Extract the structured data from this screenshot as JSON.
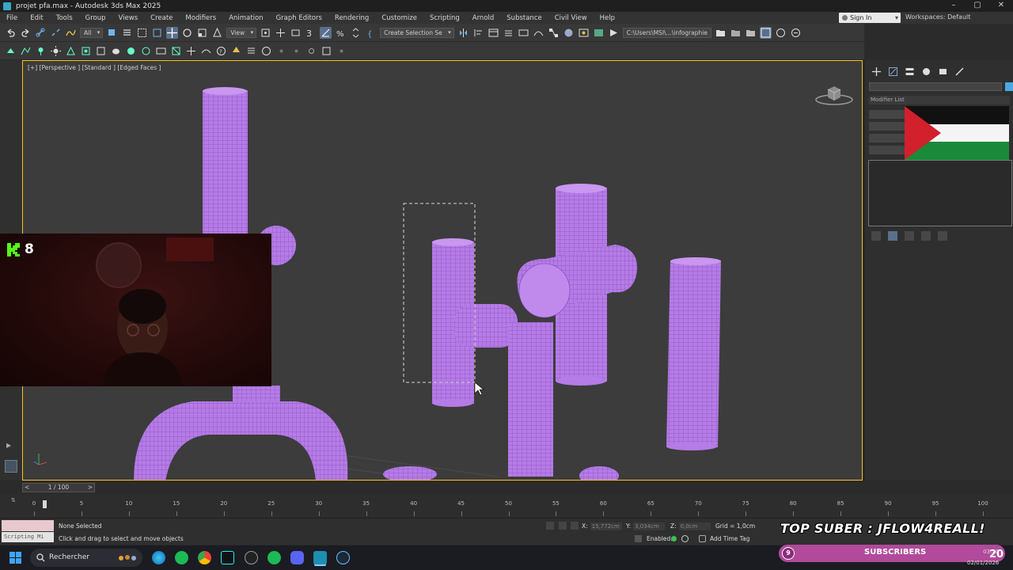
{
  "window": {
    "title": "projet pfa.max - Autodesk 3ds Max 2025",
    "controls": [
      "–",
      "▢",
      "✕"
    ]
  },
  "menu": {
    "items": [
      "File",
      "Edit",
      "Tools",
      "Group",
      "Views",
      "Create",
      "Modifiers",
      "Animation",
      "Graph Editors",
      "Rendering",
      "Customize",
      "Scripting",
      "Arnold",
      "Substance",
      "Civil View",
      "Help"
    ],
    "sign_in": "Sign In",
    "workspaces_label": "Workspaces:",
    "workspace_value": "Default"
  },
  "toolbar": {
    "selection_filter": "All",
    "ref_coord": "View",
    "named_selection": "Create Selection Se",
    "project_path": "C:\\Users\\MSI\\...\\infographie"
  },
  "viewport": {
    "label": "[+] [Perspective ] [Standard ] [Edged Faces ]",
    "object_color": "#b57be6",
    "wire_color": "#7a3fb0",
    "border_color": "#f5c518"
  },
  "command_panel": {
    "modifier_list": "Modifier List"
  },
  "webcam_overlay": {
    "kick_count": "8",
    "kick_color": "#53fc18"
  },
  "timeline": {
    "frame_display": "1 / 100",
    "ticks": [
      0,
      5,
      10,
      15,
      20,
      25,
      30,
      35,
      40,
      45,
      50,
      55,
      60,
      65,
      70,
      75,
      80,
      85,
      90,
      95,
      100
    ]
  },
  "status": {
    "selection": "None Selected",
    "prompt": "Click and drag to select and move objects",
    "script_label": "Scripting Mi",
    "x_label": "X:",
    "x_value": "15,772cm",
    "y_label": "Y:",
    "y_value": "3,034cm",
    "z_label": "Z:",
    "z_value": "0,0cm",
    "grid": "Grid = 1,0cm",
    "enabled": "Enabled:",
    "add_time_tag": "Add Time Tag"
  },
  "stream_overlay": {
    "top_suber": "TOP SUBER : JFLOW4REALL!",
    "subscribers_label": "SUBSCRIBERS",
    "badge_number": "9"
  },
  "taskbar": {
    "search_placeholder": "Rechercher",
    "time": "03:20",
    "date": "02/01/2026",
    "clock_big": "20"
  }
}
